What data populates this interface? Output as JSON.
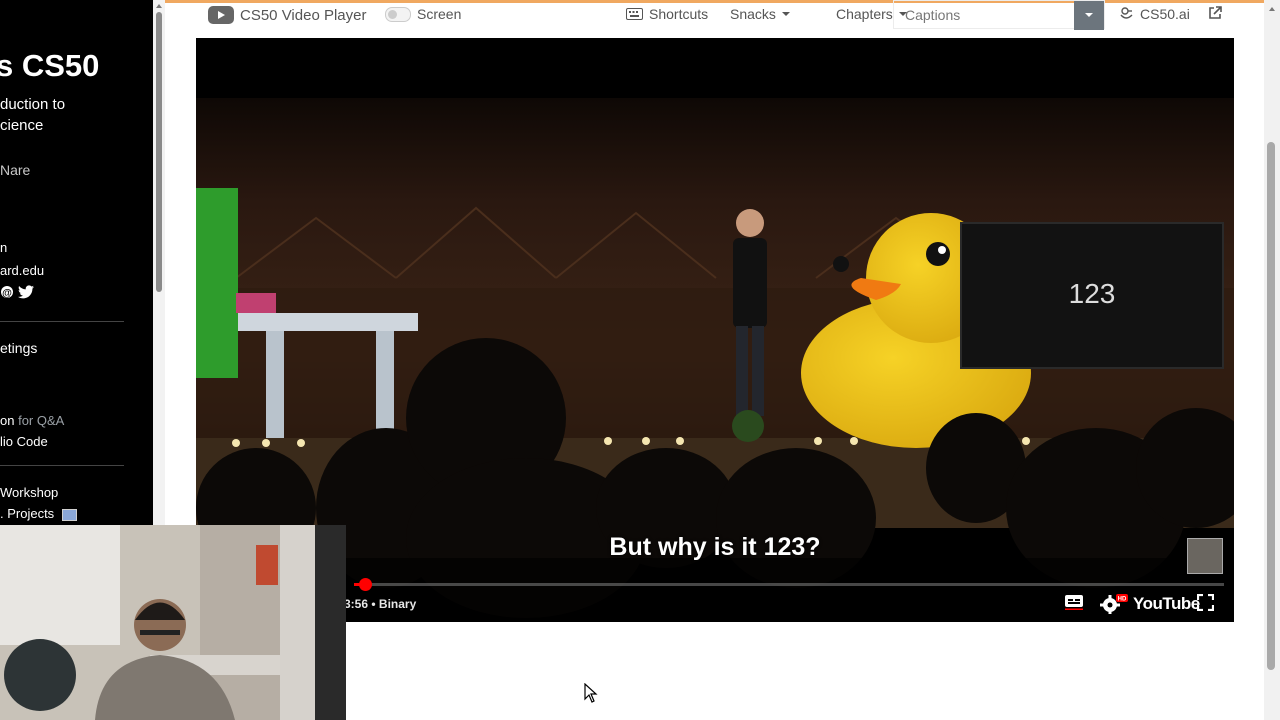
{
  "sidebar": {
    "title": "s CS50",
    "subtitle_line1": "duction to",
    "subtitle_line2": "cience",
    "instructor": "Nare",
    "line_n": "n",
    "email": "ard.edu",
    "meetings": "etings",
    "qa_prefix": "on",
    "qa_suffix": "for Q&A",
    "studio_code": "lio Code",
    "workshop": "Workshop",
    "projects": ". Projects",
    "social_icons": [
      "threads-icon",
      "twitter-icon"
    ]
  },
  "toolbar": {
    "app_title": "CS50 Video Player",
    "screen_label": "Screen",
    "shortcuts_label": "Shortcuts",
    "snacks_label": "Snacks",
    "chapters_label": "Chapters",
    "captions_placeholder": "Captions",
    "cs50ai_label": "CS50.ai"
  },
  "player": {
    "caption": "But why is it 123?",
    "screen_number": "123",
    "time_text": "3:56",
    "chapter_text": "Binary",
    "youtube_label": "YouTube",
    "hd_badge": "HD",
    "progress_fraction": 0.013
  },
  "colors": {
    "accent_top": "#f0a860",
    "progress": "#ff0000",
    "duck": "#f2c21b"
  }
}
